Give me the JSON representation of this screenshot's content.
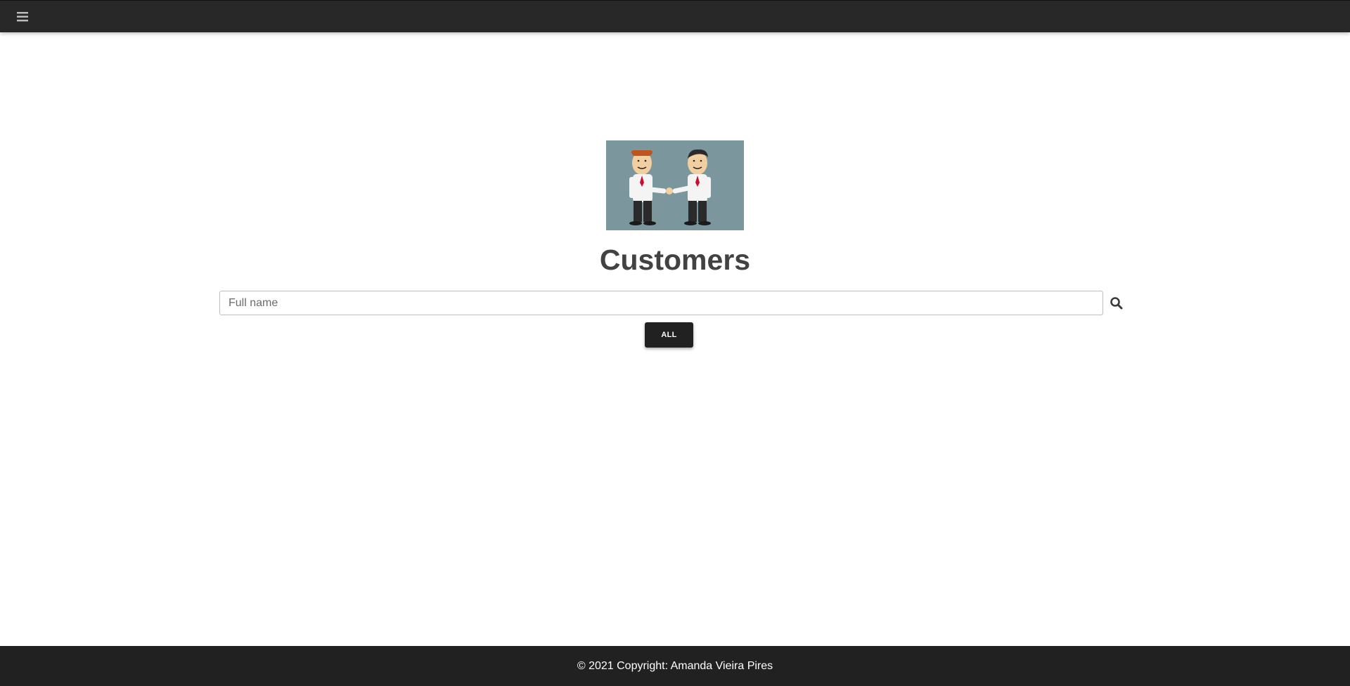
{
  "navbar": {
    "menu_icon": "hamburger-menu-icon",
    "background": "#282828"
  },
  "hero": {
    "image": "handshake-illustration",
    "background": "#7b969c"
  },
  "main": {
    "title": "Customers",
    "search": {
      "placeholder": "Full name",
      "value": "",
      "icon": "search-icon"
    },
    "all_button_label": "ALL"
  },
  "footer": {
    "text": "© 2021 Copyright: Amanda Vieira Pires",
    "background": "#212121"
  }
}
